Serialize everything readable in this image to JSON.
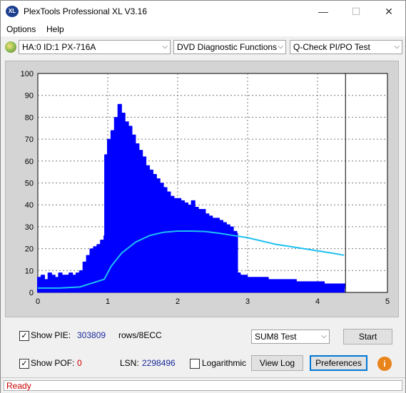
{
  "window": {
    "title": "PlexTools Professional XL V3.16",
    "app_icon_text": "XL",
    "minimize_icon": "minimize-icon",
    "maximize_icon": "maximize-icon",
    "close_icon": "close-icon"
  },
  "menu": {
    "options": "Options",
    "help": "Help"
  },
  "toolbar": {
    "drive": "HA:0 ID:1  PX-716A",
    "function": "DVD Diagnostic Functions",
    "test": "Q-Check PI/PO Test"
  },
  "chart_data": {
    "type": "bar",
    "xlim": [
      0,
      5
    ],
    "ylim": [
      0,
      100
    ],
    "x_ticks": [
      "0",
      "1",
      "2",
      "3",
      "4",
      "5"
    ],
    "y_ticks": [
      "0",
      "10",
      "20",
      "30",
      "40",
      "50",
      "60",
      "70",
      "80",
      "90",
      "100"
    ],
    "grid": true,
    "colors": {
      "bars": "#0000ff",
      "line": "#1ec0f0",
      "plot_bg": "#ffffff",
      "frame_bg": "#d4d4d4"
    },
    "series": [
      {
        "kind": "bars",
        "x": [
          0.0,
          0.05,
          0.1,
          0.15,
          0.2,
          0.25,
          0.3,
          0.35,
          0.4,
          0.45,
          0.5,
          0.55,
          0.6,
          0.65,
          0.7,
          0.75,
          0.8,
          0.85,
          0.9,
          0.95,
          0.96,
          1.0,
          1.05,
          1.1,
          1.15,
          1.2,
          1.25,
          1.3,
          1.35,
          1.4,
          1.45,
          1.5,
          1.55,
          1.6,
          1.65,
          1.7,
          1.75,
          1.8,
          1.85,
          1.9,
          1.95,
          2.0,
          2.05,
          2.1,
          2.15,
          2.2,
          2.25,
          2.3,
          2.35,
          2.4,
          2.45,
          2.5,
          2.55,
          2.6,
          2.65,
          2.7,
          2.75,
          2.8,
          2.85,
          2.86,
          2.9,
          3.0,
          3.1,
          3.2,
          3.3,
          3.4,
          3.5,
          3.6,
          3.7,
          3.8,
          3.9,
          4.0,
          4.1,
          4.2,
          4.3,
          4.38
        ],
        "values": [
          7,
          8,
          6,
          9,
          8,
          7,
          9,
          8,
          8,
          9,
          8,
          9,
          10,
          14,
          17,
          20,
          21,
          22,
          24,
          26,
          63,
          70,
          74,
          80,
          86,
          82,
          78,
          76,
          72,
          68,
          65,
          62,
          58,
          56,
          54,
          52,
          50,
          48,
          46,
          44,
          43,
          43,
          42,
          41,
          40,
          42,
          39,
          38,
          38,
          36,
          35,
          34,
          34,
          33,
          32,
          31,
          30,
          28,
          27,
          9,
          8,
          7,
          7,
          7,
          6,
          6,
          6,
          6,
          5,
          5,
          5,
          5,
          4,
          4,
          4,
          4
        ]
      },
      {
        "kind": "line",
        "x": [
          0.0,
          0.3,
          0.6,
          0.75,
          0.95,
          1.05,
          1.2,
          1.4,
          1.6,
          1.8,
          2.0,
          2.2,
          2.4,
          2.6,
          2.8,
          3.0,
          3.2,
          3.4,
          3.6,
          3.8,
          4.0,
          4.2,
          4.38
        ],
        "values": [
          2,
          2,
          2.5,
          4,
          6,
          12,
          18,
          23,
          26,
          27.5,
          28,
          28,
          27.8,
          27,
          26,
          25,
          23.5,
          22,
          21,
          20,
          19,
          18,
          17
        ]
      }
    ]
  },
  "panel": {
    "show_pie_label": "Show PIE:",
    "pie_value": "303809",
    "pie_unit": "rows/8ECC",
    "show_pof_label": "Show POF:",
    "pof_value": "0",
    "lsn_label": "LSN:",
    "lsn_value": "2298496",
    "logarithmic_label": "Logarithmic",
    "test_select": "SUM8 Test",
    "start_button": "Start",
    "view_log_button": "View Log",
    "preferences_button": "Preferences",
    "info_icon": "info-icon"
  },
  "status": {
    "text": "Ready",
    "color": "#cc0000"
  }
}
